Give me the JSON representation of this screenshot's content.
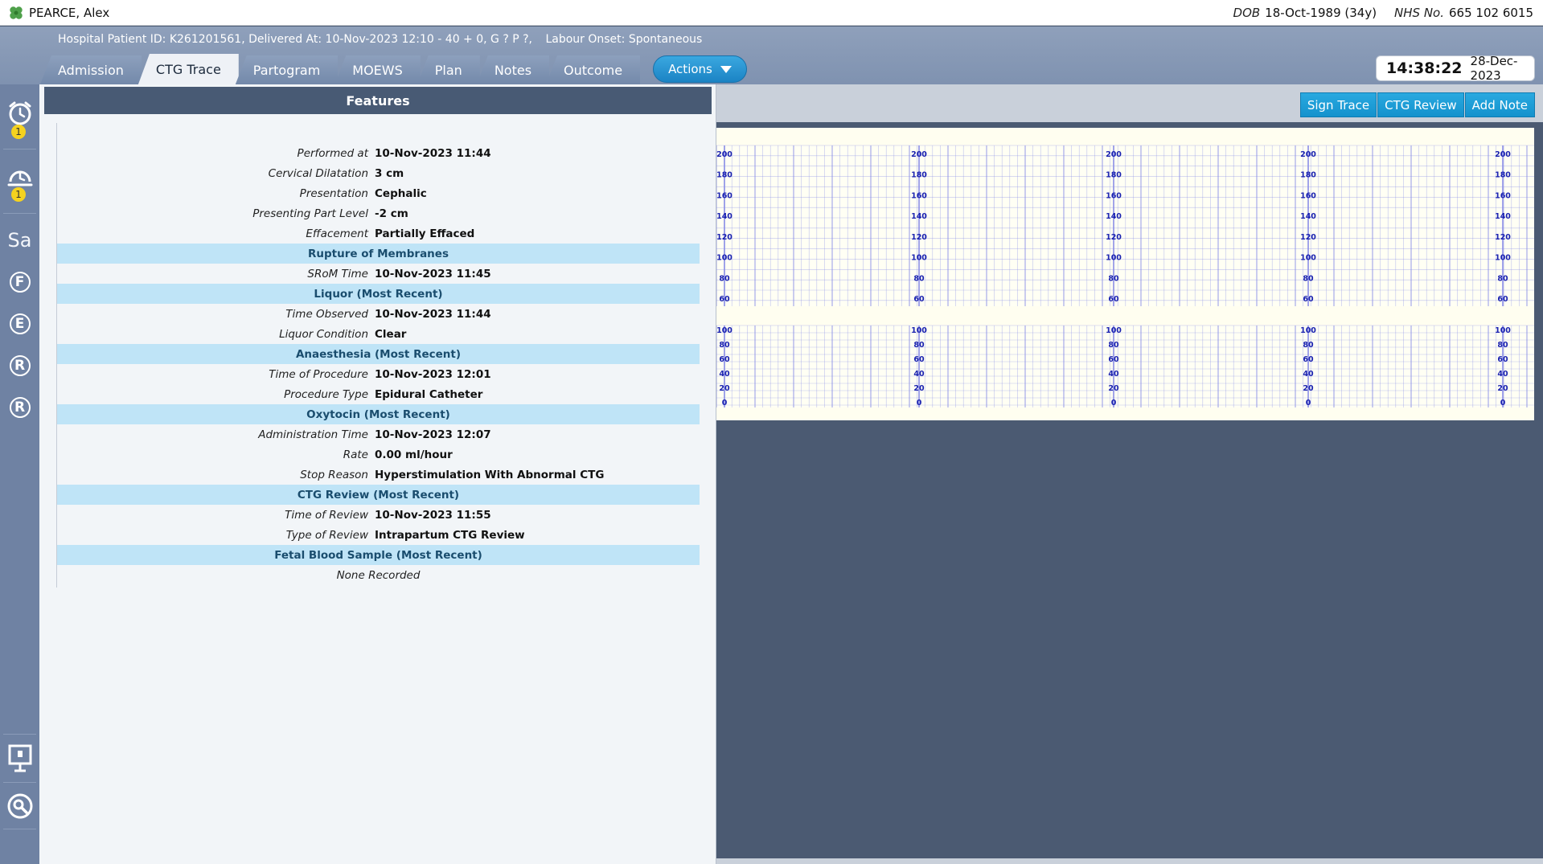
{
  "patient": {
    "name": "PEARCE, Alex",
    "dob_label": "DOB",
    "dob_value": "18-Oct-1989 (34y)",
    "nhs_label": "NHS No.",
    "nhs_value": "665 102 6015"
  },
  "header": {
    "info_id": "Hospital Patient ID: K261201561, Delivered At: 10-Nov-2023 12:10 - 40 + 0, G ? P ?,",
    "info_onset": "Labour Onset: Spontaneous",
    "tabs": [
      {
        "label": "Admission"
      },
      {
        "label": "CTG Trace"
      },
      {
        "label": "Partogram"
      },
      {
        "label": "MOEWS"
      },
      {
        "label": "Plan"
      },
      {
        "label": "Notes"
      },
      {
        "label": "Outcome"
      }
    ],
    "active_tab": "CTG Trace",
    "actions_label": "Actions",
    "clock_time": "14:38:22",
    "clock_date": "28-Dec-2023"
  },
  "sidebar": {
    "alarm_badge": "1",
    "snooze_badge": "1",
    "letters": [
      "Sa",
      "F",
      "E",
      "R",
      "R"
    ],
    "icons": [
      "alarm-clock-icon",
      "snooze-clock-icon",
      "presentation-icon",
      "search-icon"
    ]
  },
  "features": {
    "title": "Features",
    "rows_top": [
      {
        "label": "Performed at",
        "value": "10-Nov-2023 11:44"
      },
      {
        "label": "Cervical Dilatation",
        "value": "3 cm"
      },
      {
        "label": "Presentation",
        "value": "Cephalic"
      },
      {
        "label": "Presenting Part Level",
        "value": "-2 cm"
      },
      {
        "label": "Effacement",
        "value": "Partially Effaced"
      }
    ],
    "rupture": {
      "title": "Rupture of Membranes",
      "rows": [
        {
          "label": "SRoM Time",
          "value": "10-Nov-2023 11:45"
        }
      ]
    },
    "liquor": {
      "title": "Liquor (Most Recent)",
      "rows": [
        {
          "label": "Time Observed",
          "value": "10-Nov-2023 11:44"
        },
        {
          "label": "Liquor Condition",
          "value": "Clear"
        }
      ]
    },
    "anaesthesia": {
      "title": "Anaesthesia (Most Recent)",
      "rows": [
        {
          "label": "Time of Procedure",
          "value": "10-Nov-2023 12:01"
        },
        {
          "label": "Procedure Type",
          "value": "Epidural Catheter"
        }
      ]
    },
    "oxytocin": {
      "title": "Oxytocin (Most Recent)",
      "rows": [
        {
          "label": "Administration Time",
          "value": "10-Nov-2023 12:07"
        },
        {
          "label": "Rate",
          "value": "0.00 ml/hour"
        },
        {
          "label": "Stop Reason",
          "value": "Hyperstimulation With Abnormal CTG"
        }
      ]
    },
    "ctg_review": {
      "title": "CTG Review (Most Recent)",
      "rows": [
        {
          "label": "Time of Review",
          "value": "10-Nov-2023 11:55"
        },
        {
          "label": "Type of Review",
          "value": "Intrapartum CTG Review"
        }
      ]
    },
    "fbs": {
      "title": "Fetal Blood Sample (Most Recent)",
      "none": "None Recorded"
    }
  },
  "trace": {
    "buttons": [
      {
        "label": "Sign Trace"
      },
      {
        "label": "CTG Review"
      },
      {
        "label": "Add Note"
      }
    ],
    "fhr_ticks": [
      "200",
      "180",
      "160",
      "140",
      "120",
      "100",
      "80",
      "60"
    ],
    "toco_ticks": [
      "100",
      "80",
      "60",
      "40",
      "20",
      "0"
    ]
  },
  "colors": {
    "grid": "#8a8ee6",
    "tick_text": "#1a22b0",
    "section_bg": "#bfe4f7",
    "accent": "#1b83c4"
  }
}
